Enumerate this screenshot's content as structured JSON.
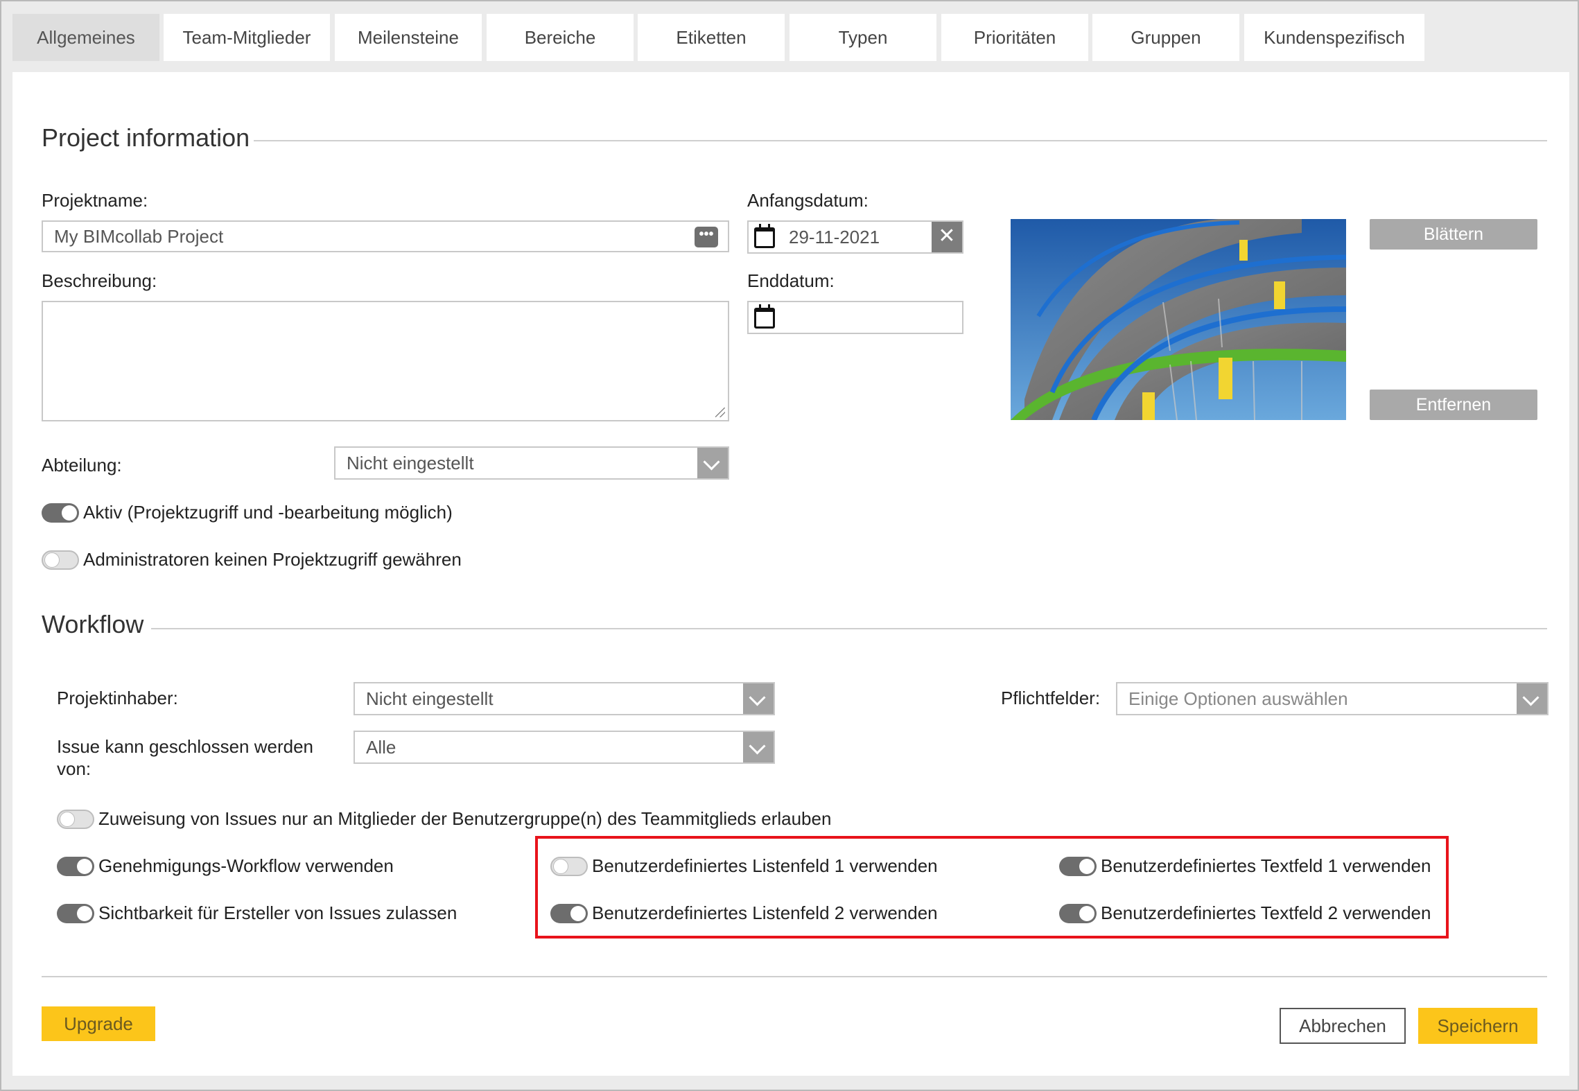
{
  "tabs": [
    {
      "label": "Allgemeines",
      "active": true
    },
    {
      "label": "Team-Mitglieder",
      "active": false
    },
    {
      "label": "Meilensteine",
      "active": false
    },
    {
      "label": "Bereiche",
      "active": false
    },
    {
      "label": "Etiketten",
      "active": false
    },
    {
      "label": "Typen",
      "active": false
    },
    {
      "label": "Prioritäten",
      "active": false
    },
    {
      "label": "Gruppen",
      "active": false
    },
    {
      "label": "Kundenspezifisch",
      "active": false
    }
  ],
  "project_info": {
    "title": "Project information",
    "name_label": "Projektname:",
    "name_value": "My BIMcollab Project",
    "name_dots": "•••",
    "description_label": "Beschreibung:",
    "description_value": "",
    "start_label": "Anfangsdatum:",
    "start_value": "29-11-2021",
    "clear_glyph": "✕",
    "end_label": "Enddatum:",
    "end_value": "",
    "department_label": "Abteilung:",
    "department_value": "Nicht eingestellt",
    "browse_label": "Blättern",
    "remove_label": "Entfernen",
    "toggle_active_label": "Aktiv (Projektzugriff und -bearbeitung möglich)",
    "toggle_active_on": true,
    "toggle_admin_label": "Administratoren keinen Projektzugriff gewähren",
    "toggle_admin_on": false
  },
  "workflow": {
    "title": "Workflow",
    "owner_label": "Projektinhaber:",
    "owner_value": "Nicht eingestellt",
    "closable_label_1": "Issue kann geschlossen werden",
    "closable_label_2": "von:",
    "closable_value": "Alle",
    "required_label": "Pflichtfelder:",
    "required_placeholder": "Einige Optionen auswählen",
    "toggle_assign_label": "Zuweisung von Issues nur an Mitglieder der Benutzergruppe(n) des Teammitglieds erlauben",
    "toggle_assign_on": false,
    "toggle_approval_label": "Genehmigungs-Workflow verwenden",
    "toggle_approval_on": true,
    "toggle_visibility_label": "Sichtbarkeit für Ersteller von Issues zulassen",
    "toggle_visibility_on": true,
    "toggle_list1_label": "Benutzerdefiniertes Listenfeld 1 verwenden",
    "toggle_list1_on": false,
    "toggle_list2_label": "Benutzerdefiniertes Listenfeld 2 verwenden",
    "toggle_list2_on": true,
    "toggle_text1_label": "Benutzerdefiniertes Textfeld 1 verwenden",
    "toggle_text1_on": true,
    "toggle_text2_label": "Benutzerdefiniertes Textfeld 2 verwenden",
    "toggle_text2_on": true
  },
  "footer": {
    "upgrade_label": "Upgrade",
    "cancel_label": "Abbrechen",
    "save_label": "Speichern"
  },
  "colors": {
    "accent_yellow": "#fcc51a",
    "highlight_red": "#e8131b",
    "toggle_on": "#6d6d6d"
  }
}
